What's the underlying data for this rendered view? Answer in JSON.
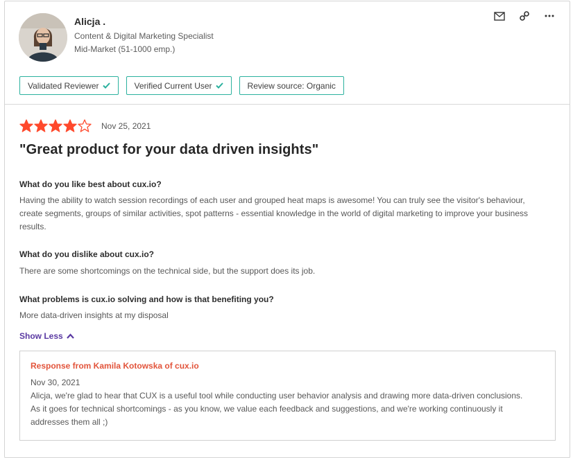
{
  "reviewer": {
    "name": "Alicja .",
    "title": "Content & Digital Marketing Specialist",
    "segment": "Mid-Market (51-1000 emp.)"
  },
  "actions": {
    "icons": [
      "mail-icon",
      "link-icon",
      "more-icon"
    ]
  },
  "badges": [
    {
      "label": "Validated Reviewer",
      "check": true
    },
    {
      "label": "Verified Current User",
      "check": true
    },
    {
      "label": "Review source: Organic",
      "check": false
    }
  ],
  "review": {
    "rating": 4,
    "max_rating": 5,
    "date": "Nov 25, 2021",
    "title": "\"Great product for your data driven insights\"",
    "questions": [
      {
        "q": "What do you like best about cux.io?",
        "a": "Having the ability to watch session recordings of each user and grouped heat maps is awesome! You can truly see the visitor's behaviour, create segments, groups of similar activities, spot patterns - essential knowledge in the world of digital marketing to improve your business results."
      },
      {
        "q": "What do you dislike about cux.io?",
        "a": "There are some shortcomings on the technical side, but the support does its job."
      },
      {
        "q": "What problems is cux.io solving and how is that benefiting you?",
        "a": "More data-driven insights at my disposal"
      }
    ],
    "show_less": "Show Less"
  },
  "response": {
    "header": "Response from Kamila Kotowska of cux.io",
    "date": "Nov 30, 2021",
    "text": "Alicja, we're glad to hear that CUX is a useful tool while conducting user behavior analysis and drawing more data-driven conclusions. As it goes for technical shortcomings - as you know, we value each feedback and suggestions, and we're working continuously it addresses them all ;)"
  },
  "colors": {
    "star": "#ff492c",
    "badge_border": "#2bb19e",
    "link": "#5a39a2",
    "response_header": "#e2543b"
  }
}
